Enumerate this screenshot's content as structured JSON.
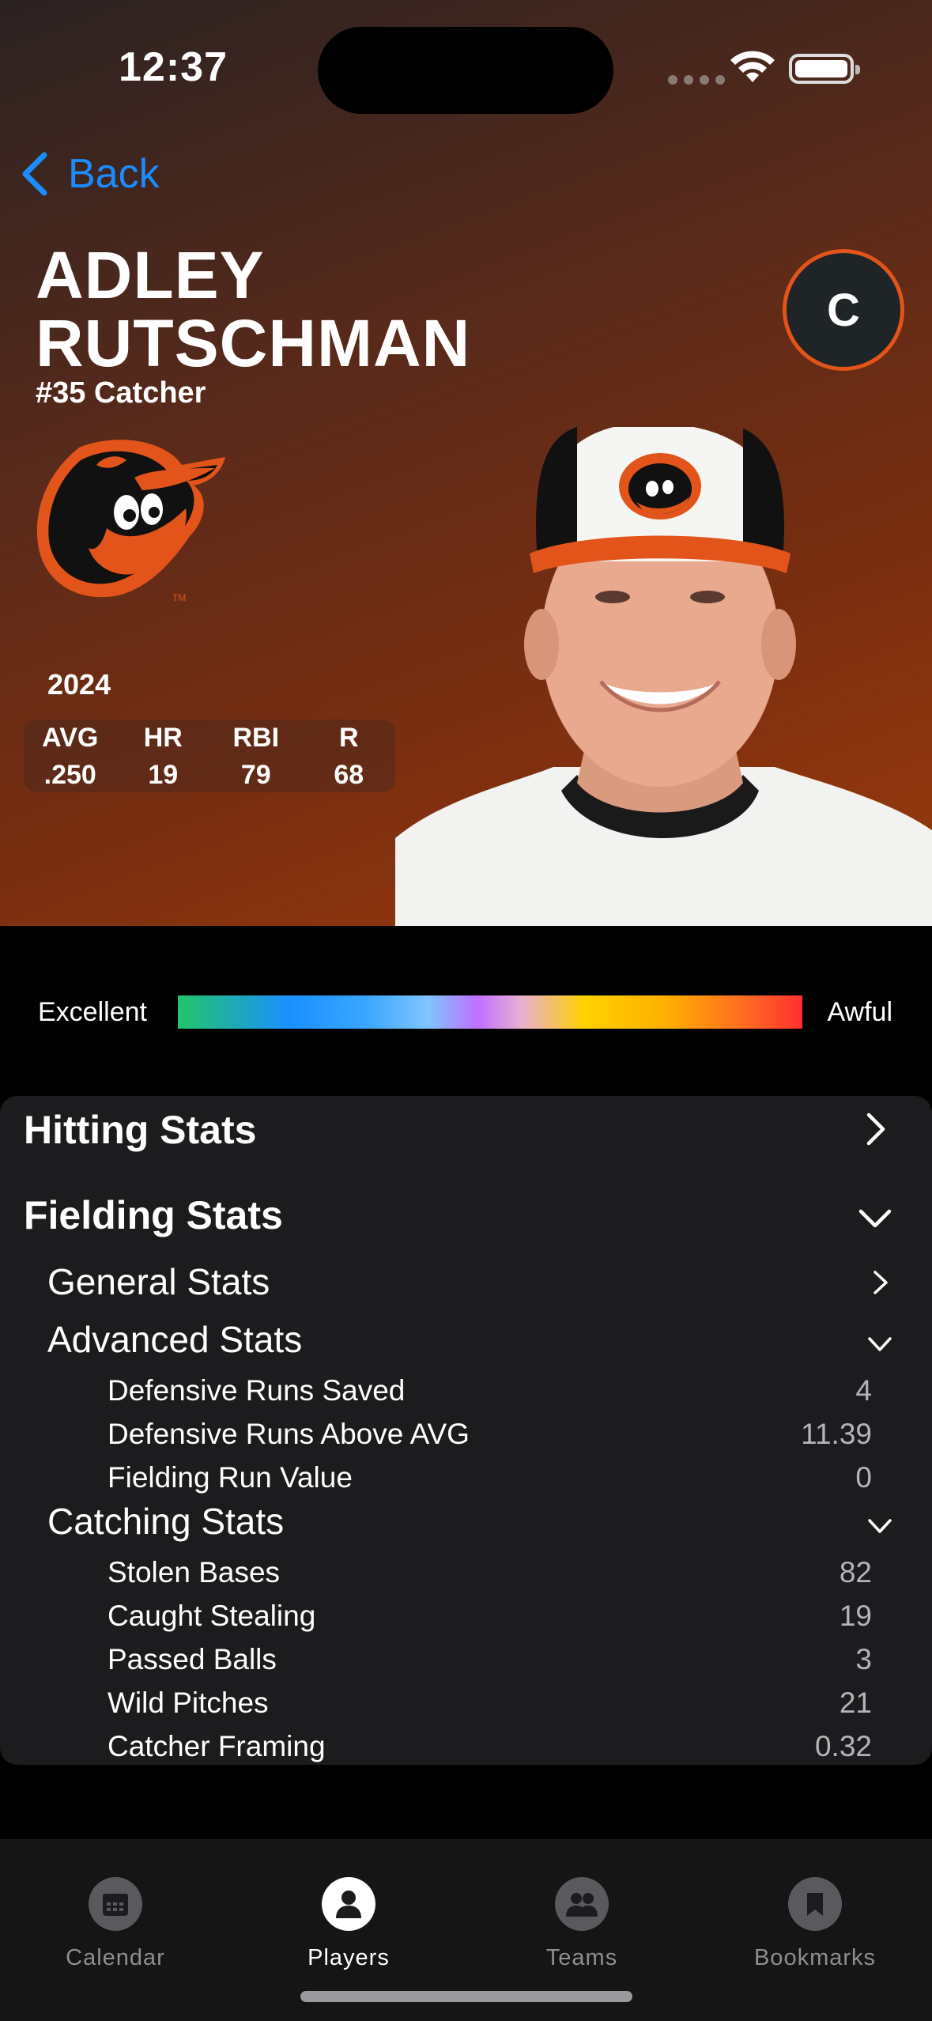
{
  "status_bar": {
    "time": "12:37"
  },
  "nav": {
    "back_label": "Back"
  },
  "player": {
    "name_line1": "ADLEY",
    "name_line2": "RUTSCHMAN",
    "subtitle": "#35 Catcher",
    "position_badge": "C",
    "team_logo": "orioles-bird-logo"
  },
  "season": {
    "year": "2024",
    "stats": [
      {
        "label": "AVG",
        "value": ".250"
      },
      {
        "label": "HR",
        "value": "19"
      },
      {
        "label": "RBI",
        "value": "79"
      },
      {
        "label": "R",
        "value": "68"
      }
    ]
  },
  "scale": {
    "left_label": "Excellent",
    "right_label": "Awful"
  },
  "sections": {
    "hitting": {
      "title": "Hitting Stats"
    },
    "fielding": {
      "title": "Fielding Stats",
      "general": {
        "title": "General Stats"
      },
      "advanced": {
        "title": "Advanced Stats",
        "rows": [
          {
            "label": "Defensive Runs Saved",
            "value": "4"
          },
          {
            "label": "Defensive Runs Above AVG",
            "value": "11.39"
          },
          {
            "label": "Fielding Run Value",
            "value": "0"
          }
        ]
      },
      "catching": {
        "title": "Catching Stats",
        "rows": [
          {
            "label": "Stolen Bases",
            "value": "82"
          },
          {
            "label": "Caught Stealing",
            "value": "19"
          },
          {
            "label": "Passed Balls",
            "value": "3"
          },
          {
            "label": "Wild Pitches",
            "value": "21"
          },
          {
            "label": "Catcher Framing",
            "value": "0.32"
          }
        ]
      }
    }
  },
  "tabbar": {
    "tabs": [
      {
        "label": "Calendar",
        "icon": "calendar-icon"
      },
      {
        "label": "Players",
        "icon": "person-icon"
      },
      {
        "label": "Teams",
        "icon": "people-icon"
      },
      {
        "label": "Bookmarks",
        "icon": "bookmark-icon"
      }
    ],
    "active": "Players"
  },
  "colors": {
    "accent": "#1a8cff",
    "badge_ring": "#e2541a",
    "orioles_orange": "#e2541a"
  }
}
